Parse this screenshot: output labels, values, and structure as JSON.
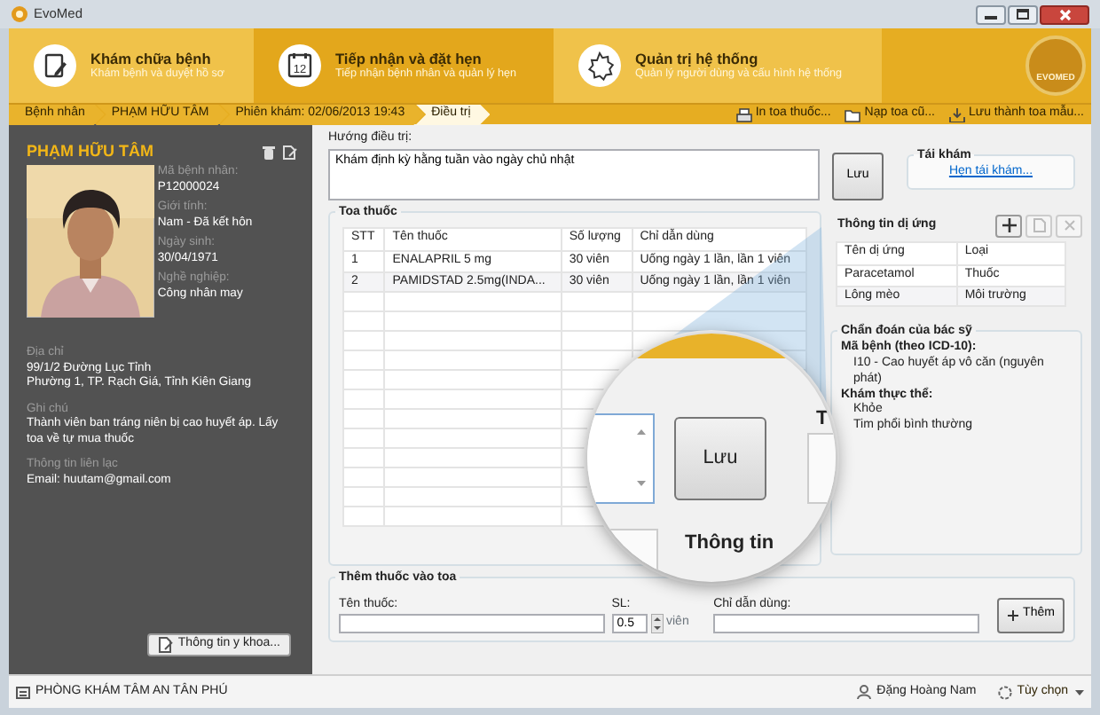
{
  "window": {
    "title": "EvoMed"
  },
  "ribbon": {
    "logo_text": "EVOMED",
    "tabs": [
      {
        "kind": "notepad",
        "title": "Khám chữa bệnh",
        "subtitle": "Khám bệnh và duyệt hồ sơ",
        "selected": false
      },
      {
        "kind": "calendar",
        "icon_text": "12",
        "title": "Tiếp nhận và đặt hẹn",
        "subtitle": "Tiếp nhận bệnh nhân và quản lý hẹn",
        "selected": true
      },
      {
        "kind": "gear",
        "title": "Quản trị hệ thống",
        "subtitle": "Quản lý người dùng và cấu hình hệ thống",
        "selected": false
      }
    ]
  },
  "breadcrumb": [
    {
      "label": "Bệnh nhân",
      "current": false
    },
    {
      "label": "PHẠM HỮU TÂM",
      "current": false
    },
    {
      "label": "Phiên khám: 02/06/2013 19:43",
      "current": false
    },
    {
      "label": "Điều trị",
      "current": true
    }
  ],
  "toolbar": [
    {
      "kind": "print",
      "label": "In toa thuốc..."
    },
    {
      "kind": "open",
      "label": "Nạp toa cũ..."
    },
    {
      "kind": "save",
      "label": "Lưu thành toa mẫu..."
    }
  ],
  "patient": {
    "name": "PHẠM HỮU TÂM",
    "fields": [
      {
        "label": "Mã bệnh nhân:",
        "value": "P12000024"
      },
      {
        "label": "Giới tính:",
        "value": "Nam - Đã kết hôn"
      },
      {
        "label": "Ngày sinh:",
        "value": "30/04/1971"
      },
      {
        "label": "Nghề nghiệp:",
        "value": "Công nhân may"
      }
    ],
    "details": [
      {
        "label": "Địa chỉ",
        "lines": [
          "99/1/2 Đường Lục Tỉnh",
          "Phường 1, TP. Rạch Giá, Tỉnh Kiên Giang"
        ]
      },
      {
        "label": "Ghi chú",
        "lines": [
          "Thành viên ban tráng niên bị cao huyết áp. Lấy toa về tự mua thuốc"
        ]
      },
      {
        "label": "Thông tin liên lạc",
        "lines": [
          "Email: huutam@gmail.com"
        ]
      }
    ],
    "button": "Thông tin y khoa..."
  },
  "treatment": {
    "label": "Hướng điều trị:",
    "value": "Khám định kỳ hằng tuần vào ngày chủ nhật",
    "save": "Lưu"
  },
  "followup": {
    "title": "Tái khám",
    "link": "Hẹn tái khám..."
  },
  "prescription": {
    "title": "Toa thuốc",
    "columns": [
      "STT",
      "Tên thuốc",
      "Số lượng",
      "Chỉ dẫn dùng"
    ],
    "rows": [
      [
        "1",
        "ENALAPRIL 5 mg",
        "30 viên",
        "Uống ngày 1 lần, lần 1 viên"
      ],
      [
        "2",
        "PAMIDSTAD 2.5mg(INDA...",
        "30 viên",
        "Uống ngày 1 lần, lần 1 viên"
      ]
    ]
  },
  "allergies": {
    "title": "Thông tin dị ứng",
    "tools": [
      {
        "kind": "add",
        "disabled": false
      },
      {
        "kind": "edit",
        "disabled": true
      },
      {
        "kind": "delete",
        "disabled": true
      }
    ],
    "columns": [
      "Tên dị ứng",
      "Loại"
    ],
    "rows": [
      [
        "Paracetamol",
        "Thuốc"
      ],
      [
        "Lông mèo",
        "Môi trường"
      ]
    ]
  },
  "diagnosis": {
    "title": "Chẩn đoán của bác sỹ",
    "lines": [
      {
        "kind": "heading",
        "text": "Mã bệnh (theo ICD-10):"
      },
      {
        "kind": "item",
        "text": "I10 - Cao huyết áp vô căn (nguyên phát)"
      },
      {
        "kind": "heading",
        "text": "Khám thực thể:"
      },
      {
        "kind": "item",
        "text": "Khỏe"
      },
      {
        "kind": "item",
        "text": "Tim phổi bình thường"
      }
    ]
  },
  "magnifier": {
    "button": "Lưu",
    "heading": "Thông tin",
    "cut_heading": "T"
  },
  "add_drug": {
    "title": "Thêm thuốc vào toa",
    "name_label": "Tên thuốc:",
    "qty_label": "SL:",
    "qty": "0.5",
    "unit": "viên",
    "usage_label": "Chỉ dẫn dùng:",
    "button": "Thêm"
  },
  "status_bar": {
    "clinic": "PHÒNG KHÁM TÂM AN TÂN PHÚ",
    "user": "Đặng Hoàng Nam",
    "options": "Tùy chọn"
  }
}
